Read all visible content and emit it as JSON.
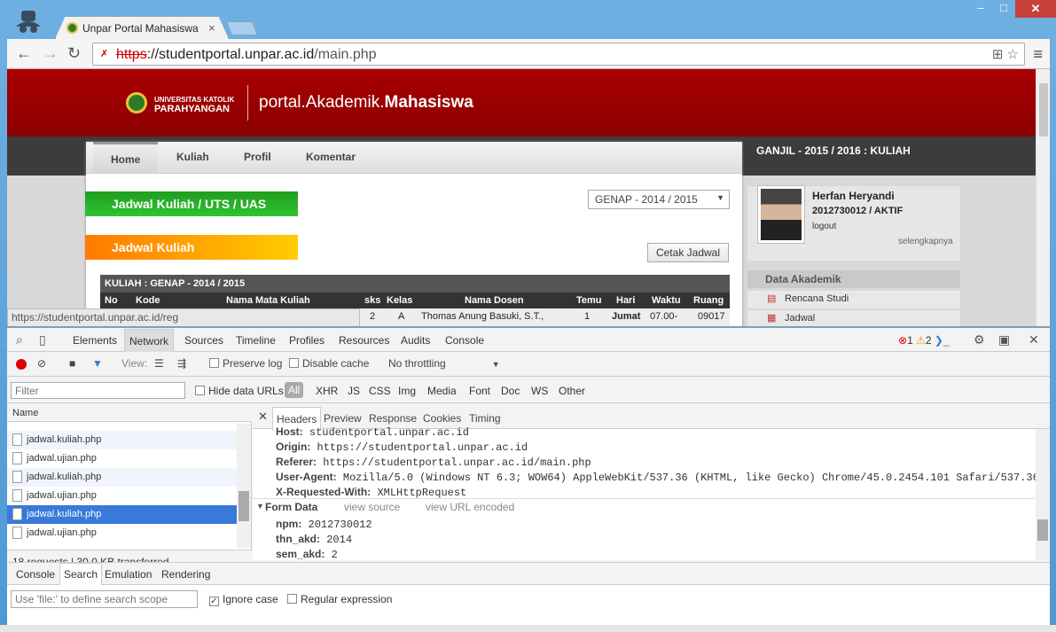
{
  "browser": {
    "tab_title": "Unpar Portal Mahasiswa",
    "url_scheme": "https",
    "url_host": "://studentportal.unpar.ac.id",
    "url_path": "/main.php",
    "status_url": "https://studentportal.unpar.ac.id/reg"
  },
  "site": {
    "logo_line1": "UNIVERSITAS KATOLIK",
    "logo_line2": "PARAHYANGAN",
    "title_light": "portal.Akademik.",
    "title_bold": "Mahasiswa",
    "semester_label": "GANJIL - 2015 / 2016 : KULIAH",
    "nav": [
      "Home",
      "Kuliah",
      "Profil",
      "Komentar"
    ],
    "green_heading": "Jadwal Kuliah / UTS / UAS",
    "orange_heading": "Jadwal Kuliah",
    "semester_select": "GENAP - 2014 / 2015",
    "print_button": "Cetak Jadwal",
    "table_title": "KULIAH : GENAP - 2014 / 2015",
    "columns": [
      "No",
      "Kode",
      "Nama Mata Kuliah",
      "sks",
      "Kelas",
      "Nama Dosen",
      "Temu",
      "Hari",
      "Waktu",
      "Ruang"
    ],
    "row": {
      "sks": "2",
      "kelas": "A",
      "dosen": "Thomas Anung Basuki, S.T.,",
      "temu": "1",
      "hari": "Jumat",
      "waktu": "07.00-",
      "ruang": "09017"
    },
    "user_name": "Herfan Heryandi",
    "user_id": "2012730012 / AKTIF",
    "logout": "logout",
    "more": "selengkapnya",
    "data_akademik": "Data Akademik",
    "links": [
      "Rencana Studi",
      "Jadwal"
    ]
  },
  "devtools": {
    "tabs": [
      "Elements",
      "Network",
      "Sources",
      "Timeline",
      "Profiles",
      "Resources",
      "Audits",
      "Console"
    ],
    "errors": "1",
    "warnings": "2",
    "view_label": "View:",
    "preserve_log": "Preserve log",
    "disable_cache": "Disable cache",
    "throttling": "No throttling",
    "filter_placeholder": "Filter",
    "hide_data_urls": "Hide data URLs",
    "types": [
      "All",
      "XHR",
      "JS",
      "CSS",
      "Img",
      "Media",
      "Font",
      "Doc",
      "WS",
      "Other"
    ],
    "name_header": "Name",
    "requests": [
      "jadwal.kuliah.php",
      "jadwal.ujian.php",
      "jadwal.kuliah.php",
      "jadwal.ujian.php",
      "jadwal.kuliah.php",
      "jadwal.ujian.php"
    ],
    "summary": "18 requests  |  30.0 KB transferred",
    "detail_tabs": [
      "Headers",
      "Preview",
      "Response",
      "Cookies",
      "Timing"
    ],
    "headers": [
      {
        "k": "Host:",
        "v": "studentportal.unpar.ac.id"
      },
      {
        "k": "Origin:",
        "v": "https://studentportal.unpar.ac.id"
      },
      {
        "k": "Referer:",
        "v": "https://studentportal.unpar.ac.id/main.php"
      },
      {
        "k": "User-Agent:",
        "v": "Mozilla/5.0 (Windows NT 6.3; WOW64) AppleWebKit/537.36 (KHTML, like Gecko) Chrome/45.0.2454.101 Safari/537.36"
      },
      {
        "k": "X-Requested-With:",
        "v": "XMLHttpRequest"
      }
    ],
    "form_data": "Form Data",
    "view_source": "view source",
    "view_url_encoded": "view URL encoded",
    "form": [
      {
        "k": "npm:",
        "v": "2012730012"
      },
      {
        "k": "thn_akd:",
        "v": "2014"
      },
      {
        "k": "sem_akd:",
        "v": "2"
      }
    ],
    "drawer_tabs": [
      "Console",
      "Search",
      "Emulation",
      "Rendering"
    ],
    "search_placeholder": "Use 'file:' to define search scope",
    "ignore_case": "Ignore case",
    "regex": "Regular expression"
  }
}
